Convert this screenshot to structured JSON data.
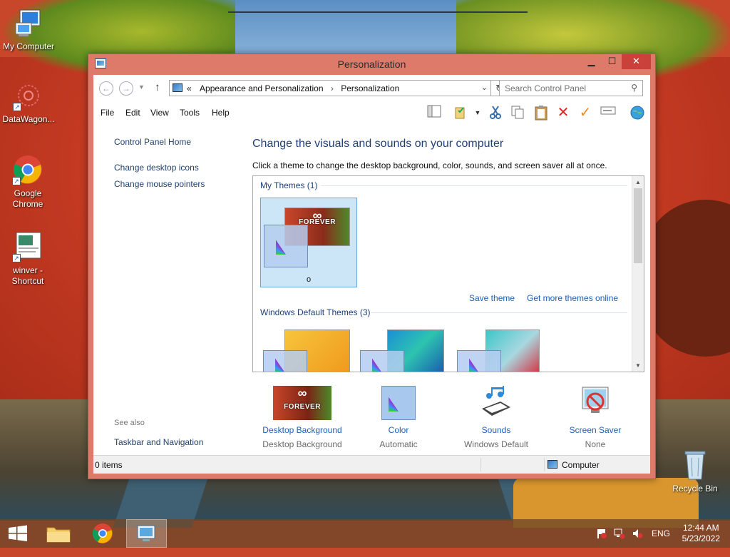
{
  "desktop": {
    "icons": [
      {
        "label": "My Computer"
      },
      {
        "label": "DataWagon..."
      },
      {
        "label": "Google Chrome"
      },
      {
        "label": "winver - Shortcut"
      },
      {
        "label": "Recycle Bin"
      }
    ]
  },
  "window": {
    "title": "Personalization",
    "controls": {
      "minimize": "▁",
      "maximize": "☐",
      "close": "✕"
    }
  },
  "address": {
    "prefix": "«",
    "crumbs": [
      "Appearance and Personalization",
      "Personalization"
    ],
    "separator": "›"
  },
  "search": {
    "placeholder": "Search Control Panel"
  },
  "menu": [
    "File",
    "Edit",
    "View",
    "Tools",
    "Help"
  ],
  "toolbar_icons": [
    "layout-icon",
    "properties-icon",
    "cut-icon",
    "copy-icon",
    "paste-icon",
    "delete-icon",
    "checkmark-icon",
    "rename-icon",
    "globe-icon"
  ],
  "left_pane": {
    "links": [
      "Control Panel Home",
      "Change desktop icons",
      "Change mouse pointers"
    ],
    "see_also_heading": "See also",
    "see_also_links": [
      "Taskbar and Navigation"
    ]
  },
  "main": {
    "title": "Change the visuals and sounds on your computer",
    "subtitle": "Click a theme to change the desktop background, color, sounds, and screen saver all at once.",
    "my_themes_label": "My Themes (1)",
    "my_theme_caption": "o",
    "save_theme_link": "Save theme",
    "get_more_link": "Get more themes online",
    "default_themes_label": "Windows Default Themes (3)",
    "thumbnail_text": "FOREVER"
  },
  "bottom_items": [
    {
      "label": "Desktop Background",
      "value": "Desktop Background"
    },
    {
      "label": "Color",
      "value": "Automatic"
    },
    {
      "label": "Sounds",
      "value": "Windows Default"
    },
    {
      "label": "Screen Saver",
      "value": "None"
    }
  ],
  "statusbar": {
    "items": "0 items",
    "location": "Computer"
  },
  "taskbar": {
    "language": "ENG",
    "time": "12:44 AM",
    "date": "5/23/2022"
  },
  "colors": {
    "window_frame": "#dd7a6a",
    "close_button": "#c9413a",
    "link_blue": "#1e5fb5",
    "heading_blue": "#1e3f7a",
    "selection_bg": "#cde6f7"
  }
}
